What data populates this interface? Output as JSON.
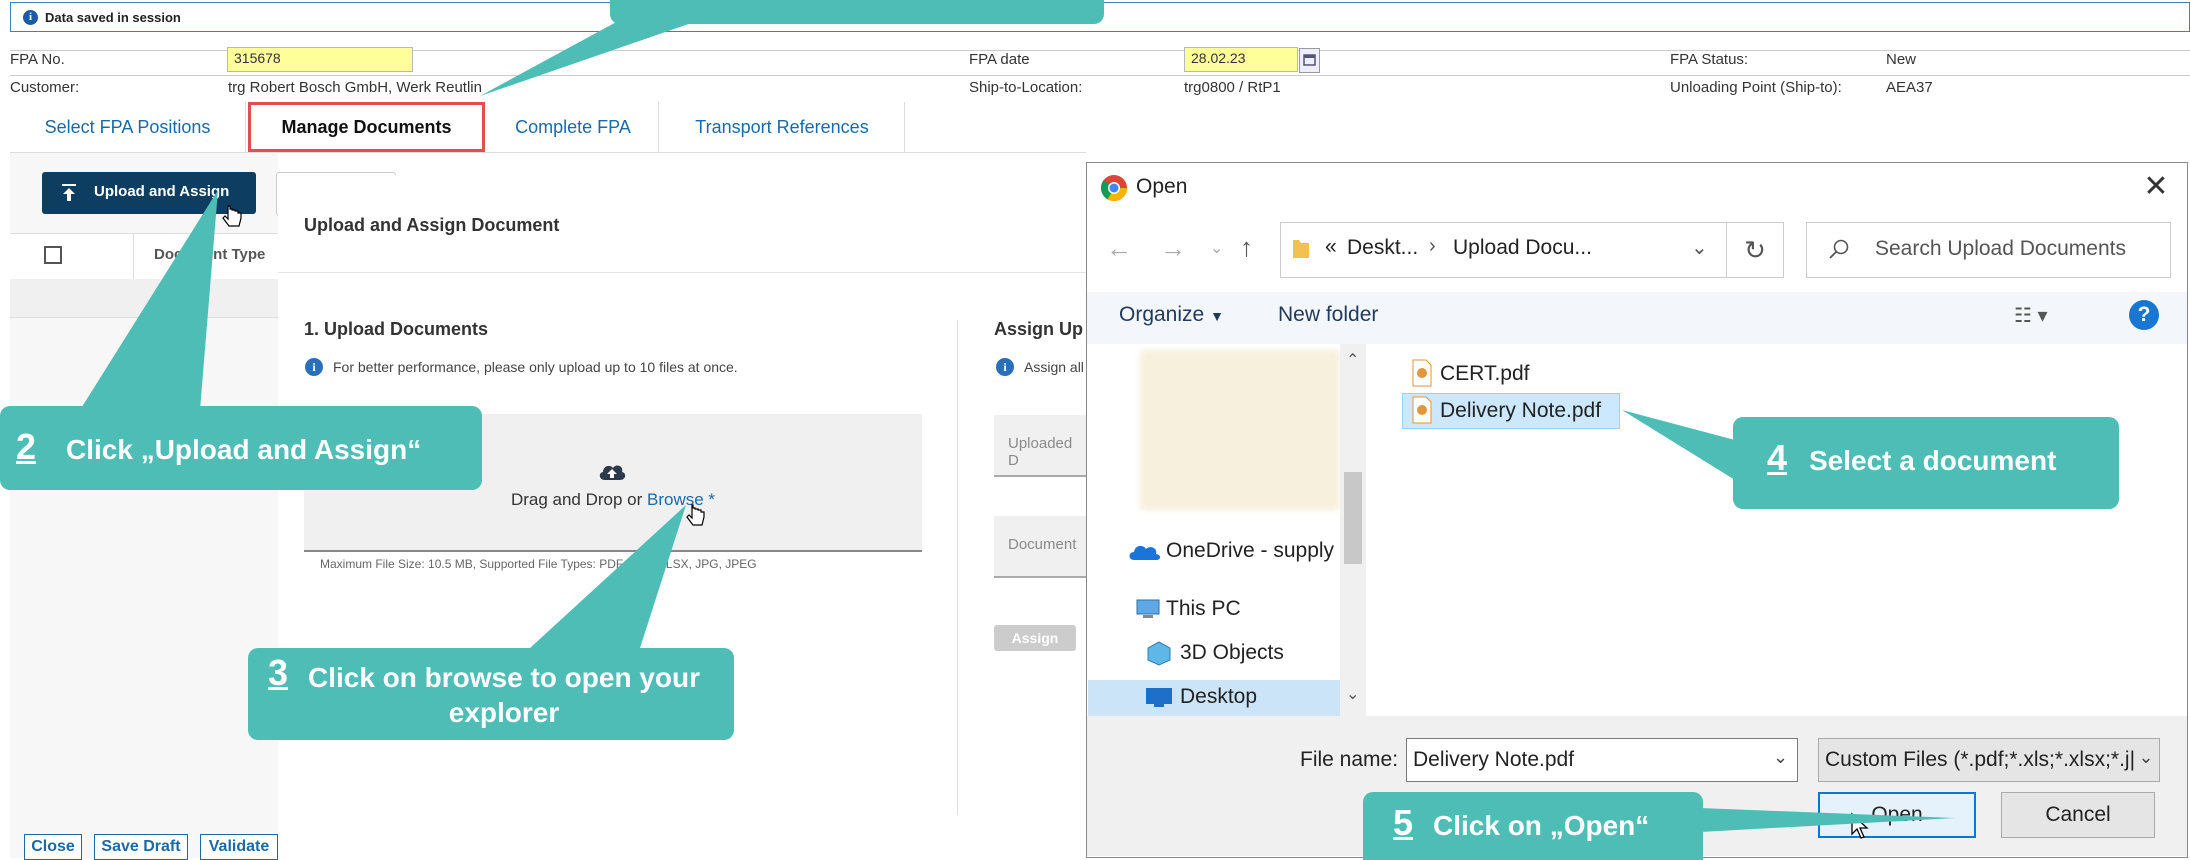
{
  "message": {
    "text": "Data saved in session"
  },
  "header": {
    "fpa_no_label": "FPA No.",
    "fpa_no_value": "315678",
    "customer_label": "Customer:",
    "customer_value": "trg Robert Bosch GmbH, Werk Reutlin",
    "fpa_date_label": "FPA date",
    "fpa_date_value": "28.02.23",
    "ship_label": "Ship-to-Location:",
    "ship_value": "trg0800 / RtP1",
    "status_label": "FPA Status:",
    "status_value": "New",
    "unloading_label": "Unloading Point (Ship-to):",
    "unloading_value": "AEA37"
  },
  "tabs": [
    {
      "label": "Select FPA Positions"
    },
    {
      "label": "Manage Documents"
    },
    {
      "label": "Complete FPA"
    },
    {
      "label": "Transport References"
    }
  ],
  "toolbar": {
    "upload_assign": "Upload and Assign"
  },
  "table": {
    "document_type": "Document Type"
  },
  "upload_dialog": {
    "title": "Upload and Assign Document",
    "section1": "1. Upload Documents",
    "info": "For better performance, please only upload up to 10 files at once.",
    "drop_text": "Drag and Drop or ",
    "browse": "Browse *",
    "limits": "Maximum File Size: 10.5 MB, Supported File Types: PDF, XLS, XLSX, JPG, JPEG",
    "section2": "Assign Up",
    "assign_info": "Assign all",
    "uploaded_placeholder": "Uploaded D",
    "document_placeholder": "Document",
    "assign_button": "Assign"
  },
  "open_dialog": {
    "title": "Open",
    "breadcrumb_prefix": "«",
    "crumb1": "Deskt...",
    "crumb2": "Upload Docu...",
    "search_placeholder": "Search Upload Documents",
    "organize": "Organize",
    "new_folder": "New folder",
    "nav_items": [
      "OneDrive - supply",
      "This PC",
      "3D Objects",
      "Desktop"
    ],
    "files": [
      "CERT.pdf",
      "Delivery Note.pdf"
    ],
    "file_name_label": "File name:",
    "file_name_value": "Delivery Note.pdf",
    "file_type": "Custom Files (*.pdf;*.xls;*.xlsx;*.j|",
    "open_button": "Open",
    "cancel_button": "Cancel"
  },
  "callouts": [
    {
      "num": "2",
      "text": "Click „Upload and Assign“"
    },
    {
      "num": "3",
      "text": "Click on browse to open your explorer"
    },
    {
      "num": "4",
      "text": "Select a document"
    },
    {
      "num": "5",
      "text": "Click on „Open“"
    }
  ],
  "footer": {
    "close": "Close",
    "save_draft": "Save Draft",
    "validate": "Validate"
  },
  "colors": {
    "callout": "#4dbdb6",
    "primary": "#0d3e62",
    "link": "#1a6aa8",
    "highlight": "#e05050"
  }
}
